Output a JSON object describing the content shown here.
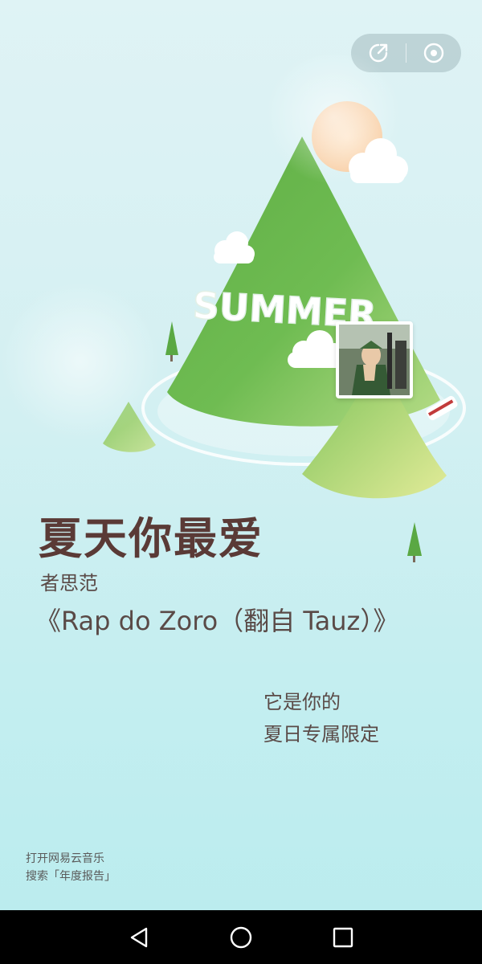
{
  "illustration": {
    "banner_text": "SUMMER"
  },
  "song_card": {
    "title": "夏天你最爱",
    "artist": "者思范",
    "song": "《Rap do Zoro（翻自 Tauz）》",
    "caption_line1": "它是你的",
    "caption_line2": "夏日专属限定"
  },
  "footer": {
    "line1": "打开网易云音乐",
    "line2": "搜索「年度报告」"
  },
  "top_actions": {
    "share_icon": "share-icon",
    "close_icon": "target-close-icon"
  },
  "navbar": {
    "back_icon": "back-triangle-icon",
    "home_icon": "home-circle-icon",
    "recents_icon": "recents-square-icon"
  },
  "colors": {
    "title_text": "#5a3a36",
    "body_text": "#5a4a47",
    "background_top": "#dff3f5",
    "background_bottom": "#b9ecee",
    "mountain_green": "#7cc259"
  }
}
